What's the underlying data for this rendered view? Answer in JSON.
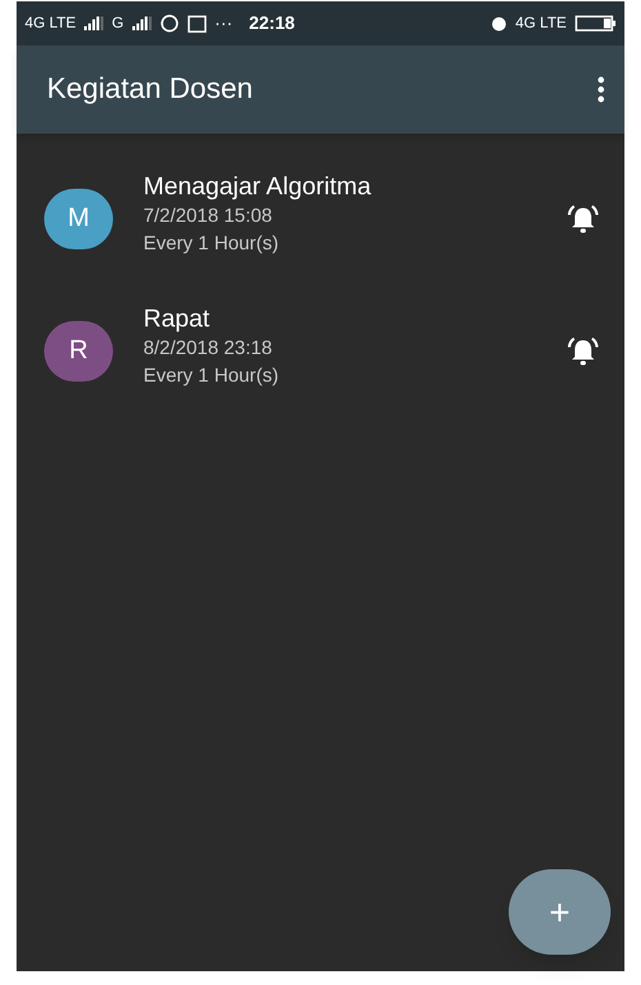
{
  "status_bar": {
    "network_1": "4G LTE",
    "network_2": "G",
    "overflow": "···",
    "time": "22:18",
    "network_right": "4G LTE"
  },
  "app_bar": {
    "title": "Kegiatan Dosen"
  },
  "events": [
    {
      "initial": "M",
      "color": "#4a9fc4",
      "title": "Menagajar Algoritma",
      "datetime": "7/2/2018 15:08",
      "repeat": "Every 1 Hour(s)"
    },
    {
      "initial": "R",
      "color": "#7d4e83",
      "title": "Rapat",
      "datetime": "8/2/2018 23:18",
      "repeat": "Every 1 Hour(s)"
    }
  ],
  "fab": {
    "label": "+"
  }
}
